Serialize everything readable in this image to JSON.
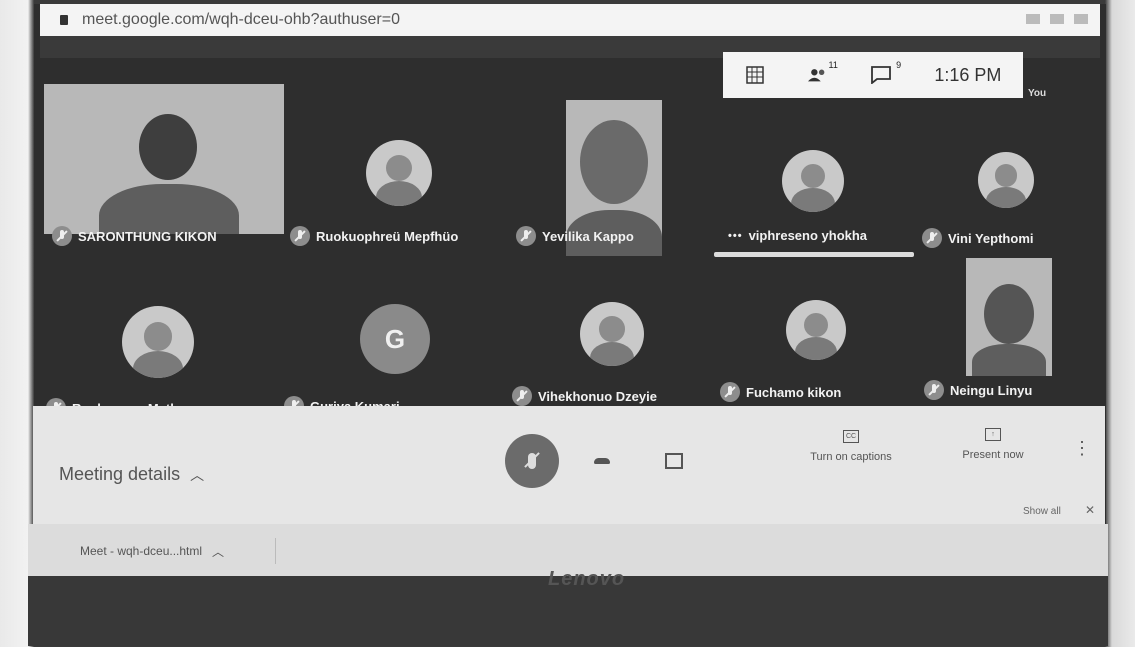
{
  "browser": {
    "url": "meet.google.com/wqh-dceu-ohb?authuser=0"
  },
  "top_panel": {
    "participants_count": "11",
    "chat_count": "9",
    "time": "1:16 PM",
    "you_label": "You"
  },
  "participants": [
    {
      "name": "SARONTHUNG KIKON"
    },
    {
      "name": "Ruokuophreü Mepfhüo"
    },
    {
      "name": "Yevilika Kappo"
    },
    {
      "name": "viphreseno yhokha"
    },
    {
      "name": "Vini Yepthomi"
    },
    {
      "name": "Ruokuonuo Metha"
    },
    {
      "name": "Guriya Kumari",
      "initial": "G"
    },
    {
      "name": "Vihekhonuo Dzeyie"
    },
    {
      "name": "Fuchamo kikon"
    },
    {
      "name": "Neingu Linyu"
    }
  ],
  "bottom_bar": {
    "meeting_details": "Meeting details",
    "captions_label": "Turn on captions",
    "present_label": "Present now",
    "cc_icon_text": "CC",
    "show_all": "Show all"
  },
  "download": {
    "filename": "Meet - wqh-dceu...html"
  },
  "hardware": {
    "brand": "Lenovo"
  }
}
